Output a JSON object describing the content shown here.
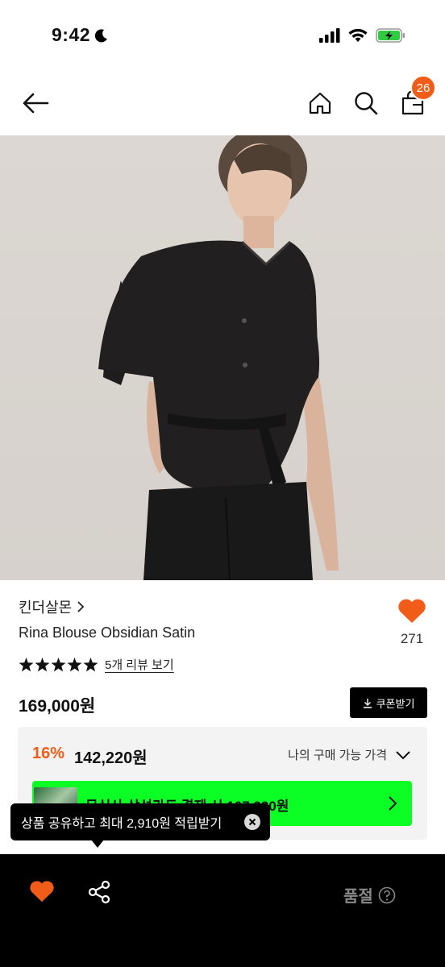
{
  "status_bar": {
    "time": "9:42"
  },
  "nav": {
    "cart_count": "26"
  },
  "product": {
    "brand": "킨더살몬",
    "name": "Rina Blouse Obsidian Satin",
    "like_count": "271",
    "rating_stars": 5,
    "review_link": "5개 리뷰 보기",
    "price": "169,000원",
    "coupon_button": "쿠폰받기"
  },
  "discount": {
    "rate": "16%",
    "price": "142,220원",
    "my_price_label": "나의 구매 가능 가격"
  },
  "card_banner": {
    "text": "무신사 삼성카드 결제 시 107,220원"
  },
  "tooltip": {
    "text": "상품 공유하고 최대 2,910원 적립받기"
  },
  "bottom_bar": {
    "soldout_label": "품절"
  },
  "colors": {
    "accent": "#f25c19",
    "banner_green": "#0bff25",
    "bottom_bar": "#000000"
  }
}
